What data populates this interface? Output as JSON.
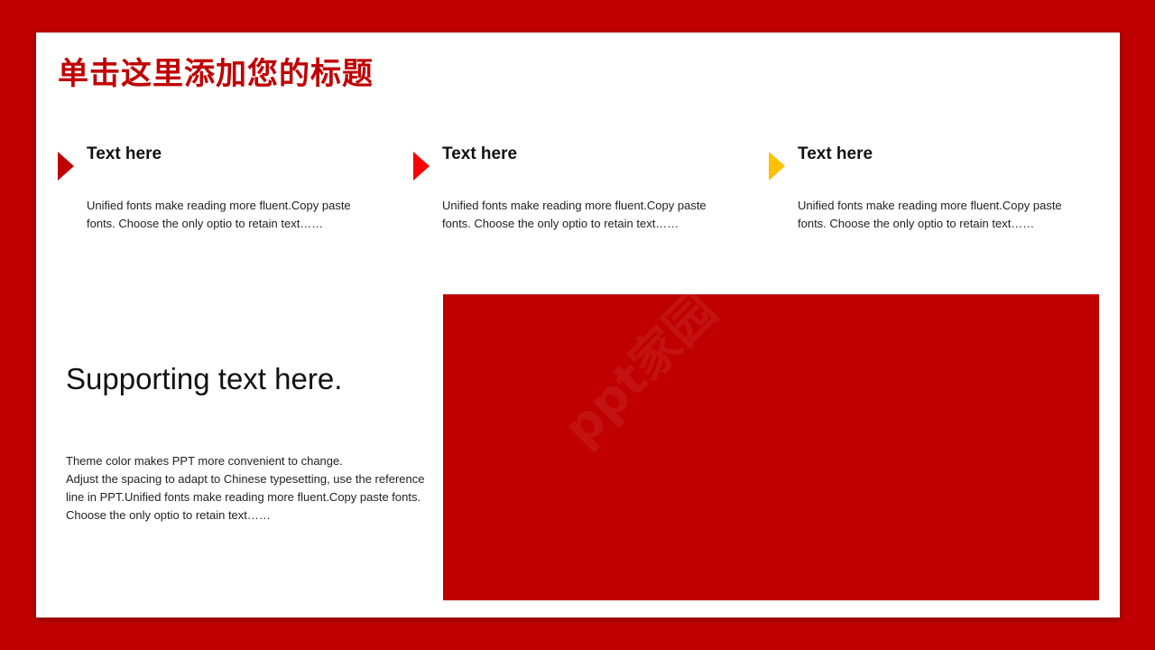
{
  "slide": {
    "title": "单击这里添加您的标题"
  },
  "features": [
    {
      "heading": "Text here",
      "body": "Unified fonts make reading more fluent.Copy paste fonts. Choose the only optio to retain text……",
      "arrow_color": "#c00000"
    },
    {
      "heading": "Text here",
      "body": "Unified fonts make reading more fluent.Copy paste fonts. Choose the only optio to retain text……",
      "arrow_color": "#ff0000"
    },
    {
      "heading": "Text here",
      "body": "Unified fonts make reading more fluent.Copy paste fonts. Choose the only optio to retain text……",
      "arrow_color": "#ffc000"
    }
  ],
  "support": {
    "title": "Supporting text here.",
    "lines": [
      "Theme  color makes PPT more convenient to change.",
      "Adjust the spacing to adapt to Chinese typesetting, use the reference line in PPT.Unified fonts make reading more fluent.Copy paste fonts. Choose the only optio to retain text……"
    ]
  },
  "image_block": {
    "color": "#c00000"
  },
  "watermark": {
    "text": "ppt家园"
  },
  "theme": {
    "background": "#c00000",
    "accent": "#c00000"
  }
}
